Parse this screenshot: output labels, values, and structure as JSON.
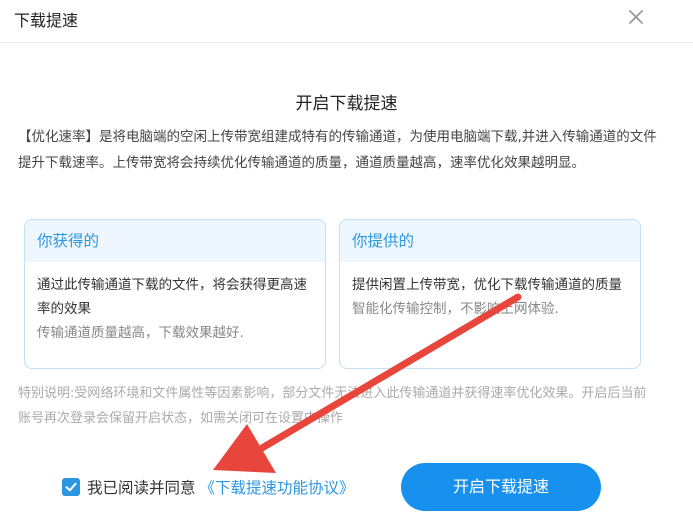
{
  "dialog": {
    "title": "下载提速",
    "close_icon": "close-icon"
  },
  "content": {
    "heading": "开启下载提速",
    "intro": "【优化速率】是将电脑端的空闲上传带宽组建成特有的传输通道，为使用电脑端下载,并进入传输通道的文件提升下载速率。上传带宽将会持续优化传输通道的质量，通道质量越高，速率优化效果越明显。",
    "cards": [
      {
        "title": "你获得的",
        "main": "通过此传输通道下载的文件，将会获得更高速率的效果",
        "sub": "传输通道质量越高，下载效果越好."
      },
      {
        "title": "你提供的",
        "main": "提供闲置上传带宽，优化下载传输通道的质量",
        "sub": "智能化传输控制，不影响上网体验."
      }
    ],
    "note": "特别说明:受网络环境和文件属性等因素影响，部分文件无法进入此传输通道并获得速率优化效果。开启后当前账号再次登录会保留开启状态，如需关闭可在设置中操作"
  },
  "footer": {
    "agree_checked": true,
    "agree_text": "我已阅读并同意",
    "agreement_link": "《下载提速功能协议》",
    "primary_button": "开启下载提速"
  },
  "colors": {
    "accent": "#1890ee",
    "link": "#2c97e0",
    "annotation_arrow": "#e8453c"
  }
}
